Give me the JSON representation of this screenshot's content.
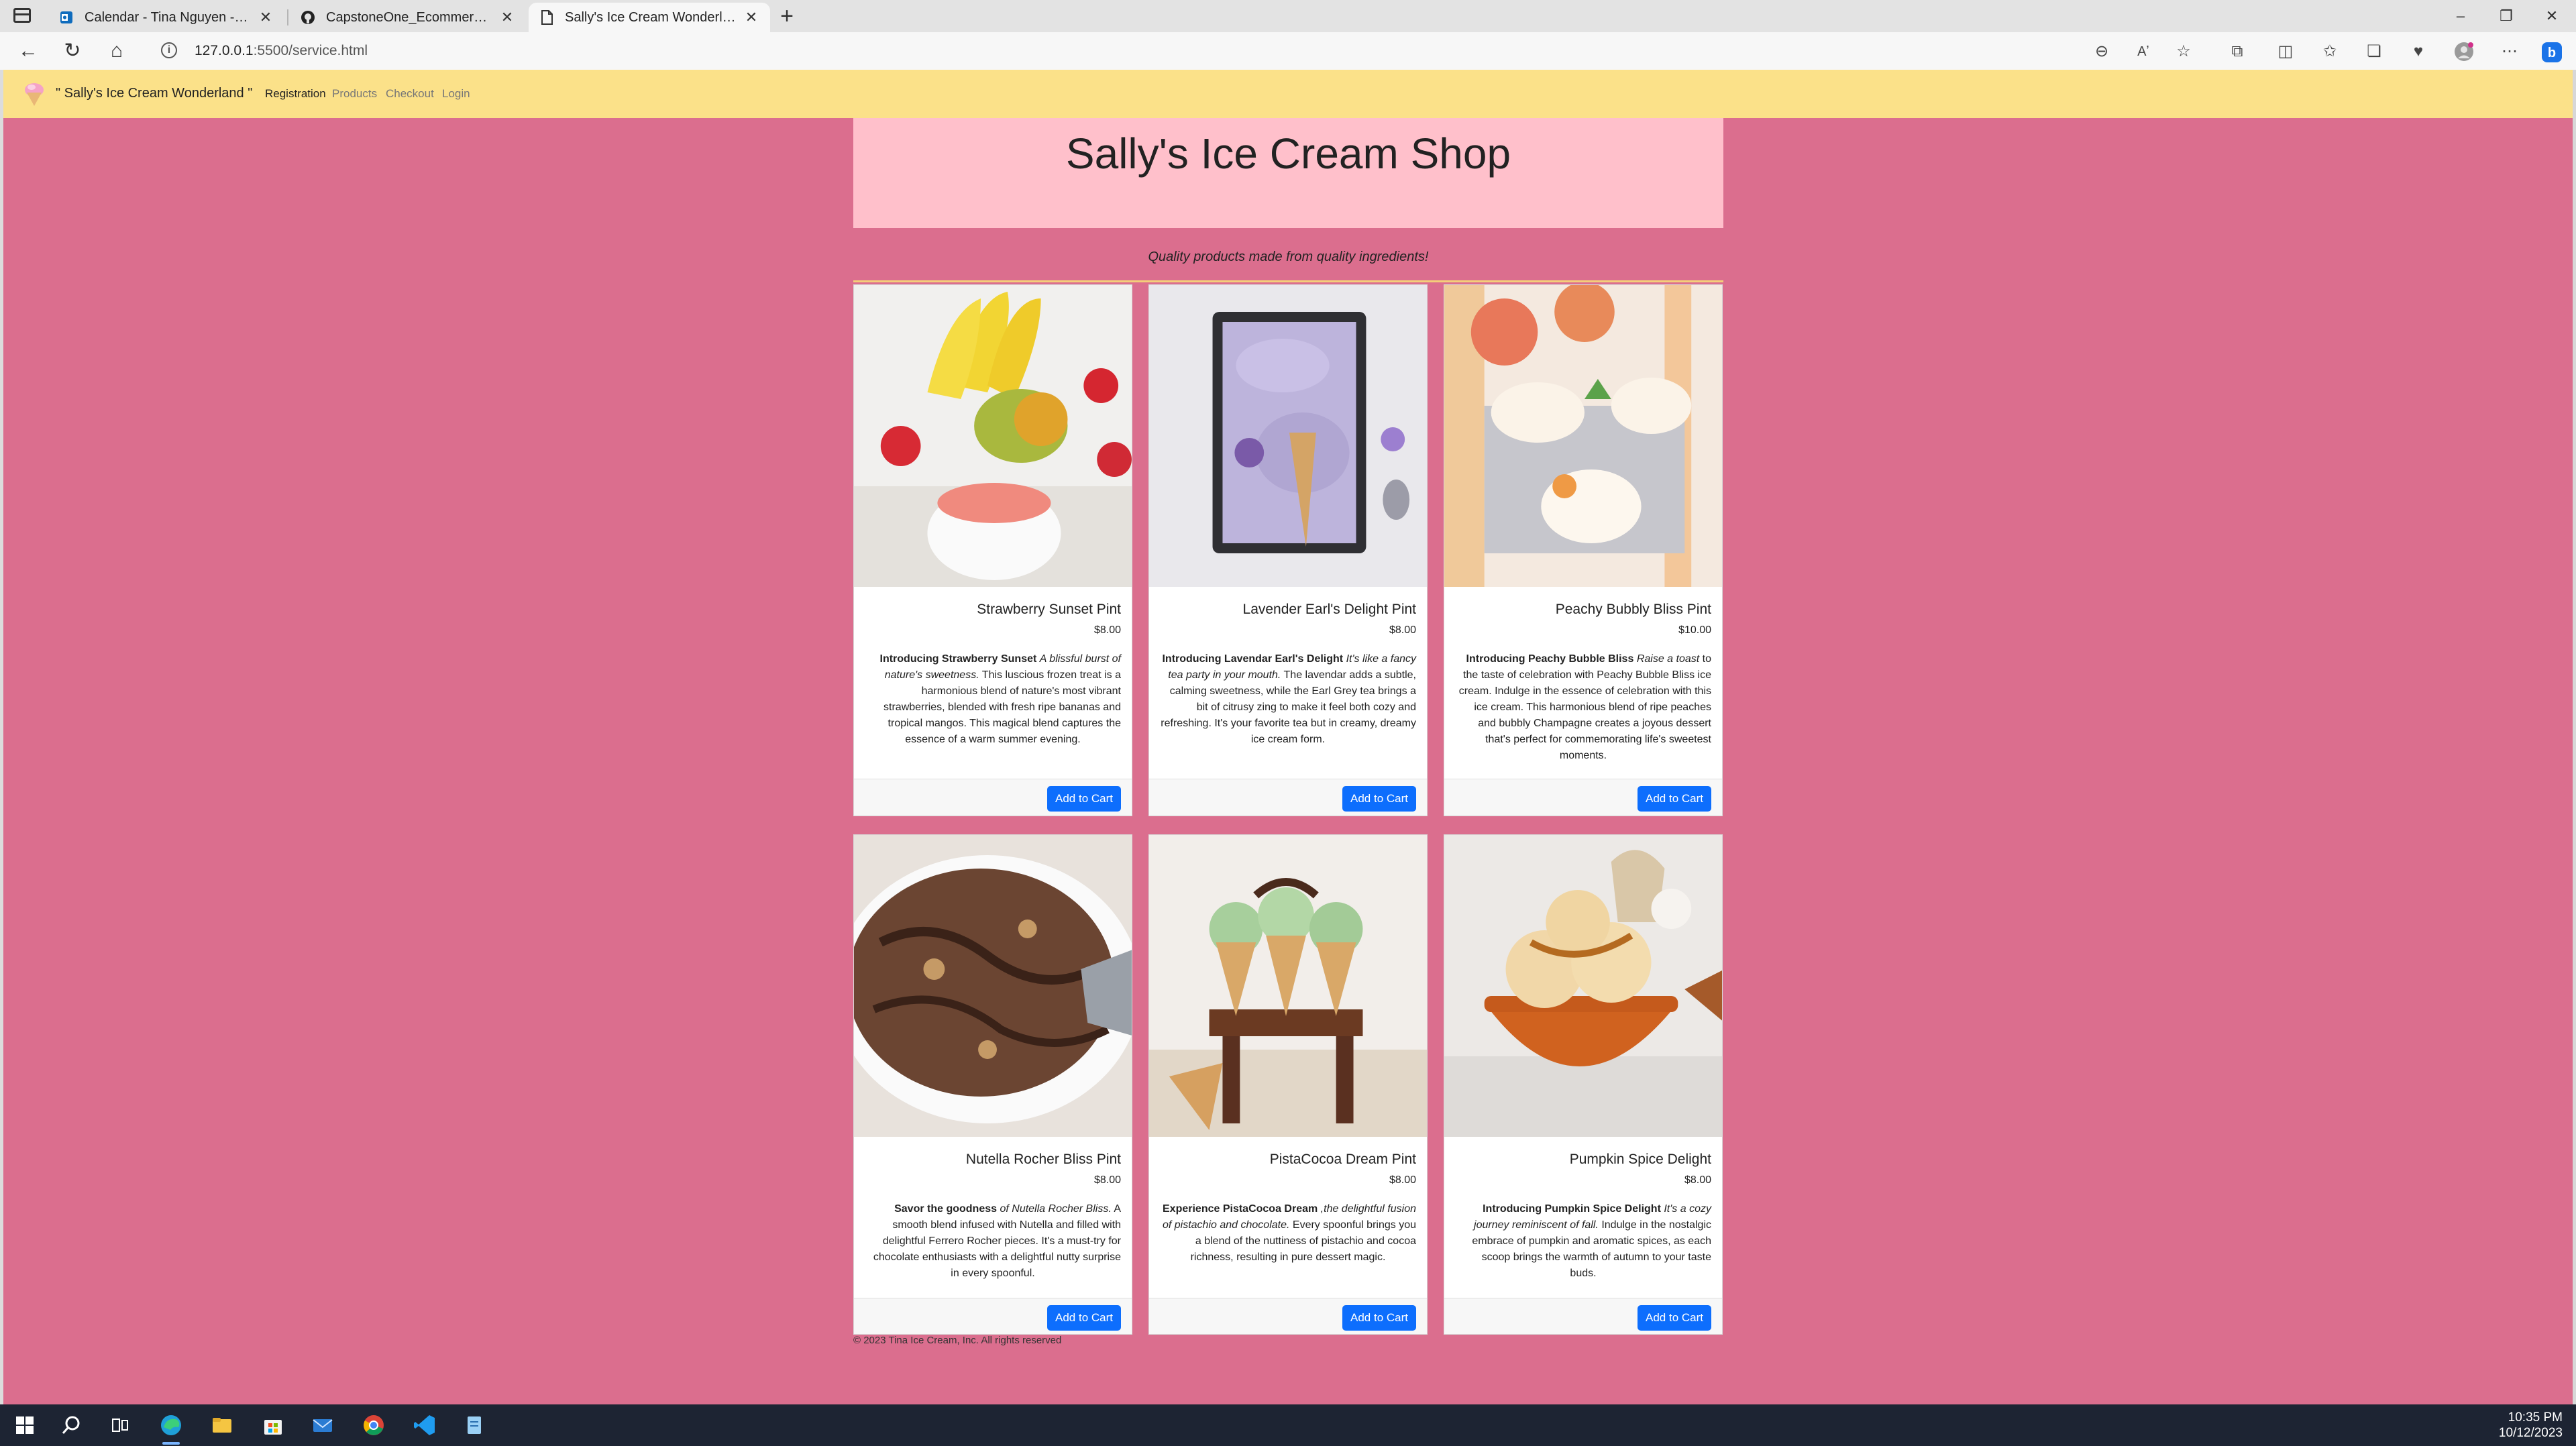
{
  "browser": {
    "tabs": [
      {
        "label": "Calendar - Tina Nguyen - Outlook",
        "icon": "outlook-icon"
      },
      {
        "label": "CapstoneOne_Ecommerce/readme",
        "icon": "github-icon"
      },
      {
        "label": "Sally's Ice Cream Wonderland!",
        "icon": "page-icon",
        "active": true
      }
    ],
    "address": {
      "host": "127.0.0.1",
      "path": ":5500/service.html"
    }
  },
  "site": {
    "brand": "\" Sally's Ice Cream Wonderland \"",
    "nav": [
      "Registration",
      "Products",
      "Checkout",
      "Login"
    ],
    "title": "Sally's Ice Cream Shop",
    "tagline": "Quality products made from quality ingredients!",
    "button_label": "Add to Cart",
    "copyright": "© 2023 Tina Ice Cream, Inc. All rights reserved"
  },
  "products": [
    {
      "name": "Strawberry Sunset Pint",
      "price": "$8.00",
      "intro": "Introducing Strawberry Sunset",
      "tagline": "A blissful burst of nature's sweetness.",
      "body": "This luscious frozen treat is a harmonious blend of nature's most vibrant strawberries, blended with fresh ripe bananas and tropical mangos. This magical blend captures the essence of a warm summer evening."
    },
    {
      "name": "Lavender Earl's Delight Pint",
      "price": "$8.00",
      "intro": "Introducing Lavendar Earl's Delight",
      "tagline": "It's like a fancy tea party in your mouth.",
      "body": "The lavendar adds a subtle, calming sweetness, while the Earl Grey tea brings a bit of citrusy zing to make it feel both cozy and refreshing. It's your favorite tea but in creamy, dreamy ice cream form."
    },
    {
      "name": "Peachy Bubbly Bliss Pint",
      "price": "$10.00",
      "intro": "Introducing Peachy Bubble Bliss",
      "tagline": "Raise a toast",
      "body": "to the taste of celebration with Peachy Bubble Bliss ice cream. Indulge in the essence of celebration with this ice cream. This harmonious blend of ripe peaches and bubbly Champagne creates a joyous dessert that's perfect for commemorating life's sweetest moments."
    },
    {
      "name": "Nutella Rocher Bliss Pint",
      "price": "$8.00",
      "intro": "Savor the goodness",
      "tagline": "of Nutella Rocher Bliss.",
      "body": "A smooth blend infused with Nutella and filled with delightful Ferrero Rocher pieces. It's a must-try for chocolate enthusiasts with a delightful nutty surprise in every spoonful."
    },
    {
      "name": "PistaCocoa Dream Pint",
      "price": "$8.00",
      "intro": "Experience PistaCocoa Dream",
      "tagline": ",the delightful fusion of pistachio and chocolate.",
      "body": "Every spoonful brings you a blend of the nuttiness of pistachio and cocoa richness, resulting in pure dessert magic."
    },
    {
      "name": "Pumpkin Spice Delight",
      "price": "$8.00",
      "intro": "Introducing Pumpkin Spice Delight",
      "tagline": "It's a cozy journey reminiscent of fall.",
      "body": "Indulge in the nostalgic embrace of pumpkin and aromatic spices, as each scoop brings the warmth of autumn to your taste buds."
    }
  ],
  "taskbar": {
    "time": "10:35 PM",
    "date": "10/12/2023"
  },
  "colors": {
    "page_bg": "#db6e8e",
    "site_nav_bg": "#fbe189",
    "header_bg": "#ffc0cb",
    "button": "#0d6efd"
  }
}
